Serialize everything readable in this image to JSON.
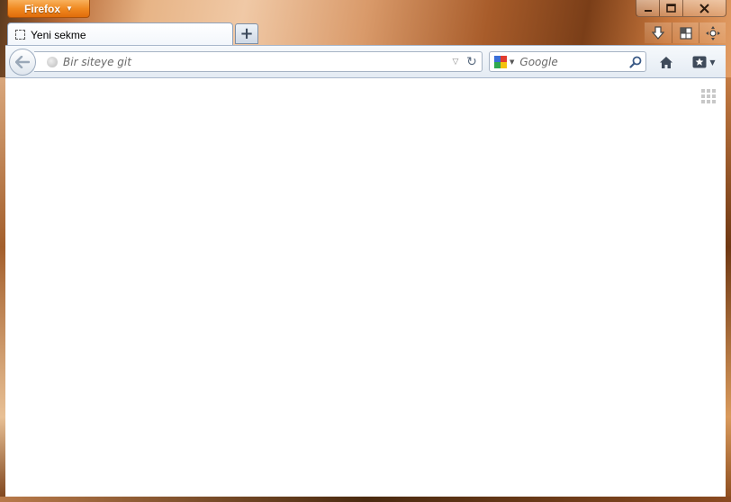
{
  "app": {
    "menu_label": "Firefox"
  },
  "tabs": [
    {
      "title": "Yeni sekme"
    }
  ],
  "urlbar": {
    "placeholder": "Bir siteye git",
    "value": ""
  },
  "search": {
    "placeholder": "Google",
    "value": ""
  },
  "icons": {
    "menu_caret": "▼",
    "new_tab": "+",
    "minimize": "—",
    "maximize": "□",
    "close": "✕",
    "url_dropdown": "▽",
    "reload": "↻"
  }
}
